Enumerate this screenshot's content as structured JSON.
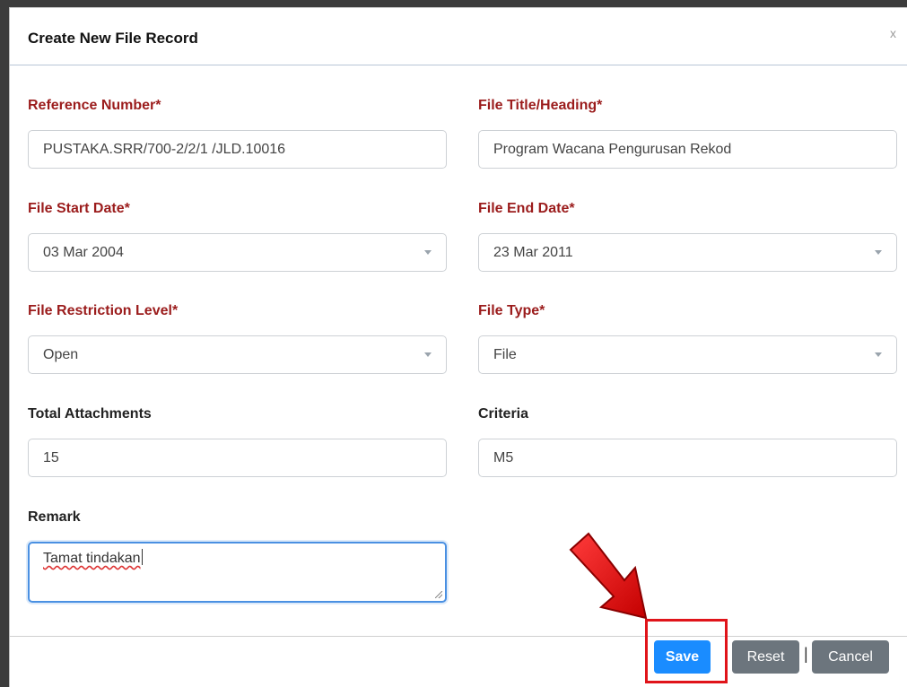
{
  "modal": {
    "title": "Create New File Record",
    "close_label": "x"
  },
  "fields": {
    "reference_number": {
      "label": "Reference Number*",
      "value": "PUSTAKA.SRR/700-2/2/1 /JLD.10016"
    },
    "file_title": {
      "label": "File Title/Heading*",
      "value": "Program Wacana Pengurusan Rekod"
    },
    "file_start_date": {
      "label": "File Start Date*",
      "value": "03 Mar 2004"
    },
    "file_end_date": {
      "label": "File End Date*",
      "value": "23 Mar 2011"
    },
    "file_restriction_level": {
      "label": "File Restriction Level*",
      "value": "Open"
    },
    "file_type": {
      "label": "File Type*",
      "value": "File"
    },
    "total_attachments": {
      "label": "Total Attachments",
      "value": "15"
    },
    "criteria": {
      "label": "Criteria",
      "value": "M5"
    },
    "remark": {
      "label": "Remark",
      "value": "Tamat tindakan"
    }
  },
  "footer": {
    "save_label": "Save",
    "reset_label": "Reset",
    "separator": "|",
    "cancel_label": "Cancel"
  },
  "colors": {
    "required_label": "#9b1c1c",
    "save_button": "#1a8cff",
    "secondary_button": "#6c757d",
    "highlight": "#e0141a"
  },
  "annotations": {
    "arrow_icon": "red-arrow-icon",
    "highlight": "red-highlight-box"
  }
}
